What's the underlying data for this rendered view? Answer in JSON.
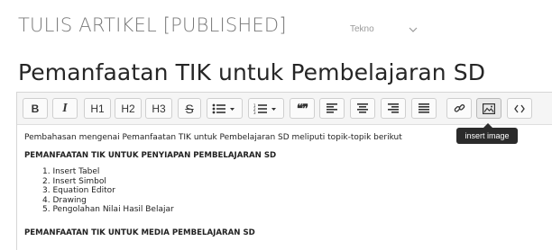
{
  "header": {
    "heading": "TULIS ARTIKEL [PUBLISHED]",
    "category": "Tekno"
  },
  "article": {
    "title": "Pemanfaatan TIK untuk Pembelajaran SD"
  },
  "toolbar": {
    "buttons": [
      {
        "name": "bold",
        "label": "B"
      },
      {
        "name": "italic",
        "label": "I"
      },
      {
        "name": "h1",
        "label": "H1"
      },
      {
        "name": "h2",
        "label": "H2"
      },
      {
        "name": "h3",
        "label": "H3"
      },
      {
        "name": "strikethrough",
        "label": "S"
      },
      {
        "name": "bullet-list",
        "icon": "bullet-list-icon"
      },
      {
        "name": "numbered-list",
        "icon": "numbered-list-icon"
      },
      {
        "name": "blockquote",
        "label": "❝❞"
      },
      {
        "name": "align-left",
        "icon": "align-left-icon"
      },
      {
        "name": "align-center",
        "icon": "align-center-icon"
      },
      {
        "name": "align-right",
        "icon": "align-right-icon"
      },
      {
        "name": "align-justify",
        "icon": "align-justify-icon"
      },
      {
        "name": "link",
        "icon": "link-icon"
      },
      {
        "name": "insert-image",
        "icon": "image-icon",
        "active": true
      },
      {
        "name": "code-view",
        "icon": "code-icon"
      }
    ],
    "tooltip": "insert image"
  },
  "content": {
    "intro": "Pembahasan mengenai Pemanfaatan TIK untuk Pembelajaran SD meliputi topik-topik berikut",
    "section1": "PEMANFAATAN TIK UNTUK PENYIAPAN PEMBELAJARAN SD",
    "items": [
      "1. Insert Tabel",
      "2. Insert Simbol",
      "3. Equation Editor",
      "4. Drawing",
      "5. Pengolahan Nilai Hasil Belajar"
    ],
    "section2": "PEMANFAATAN TIK UNTUK MEDIA PEMBELAJARAN SD"
  }
}
